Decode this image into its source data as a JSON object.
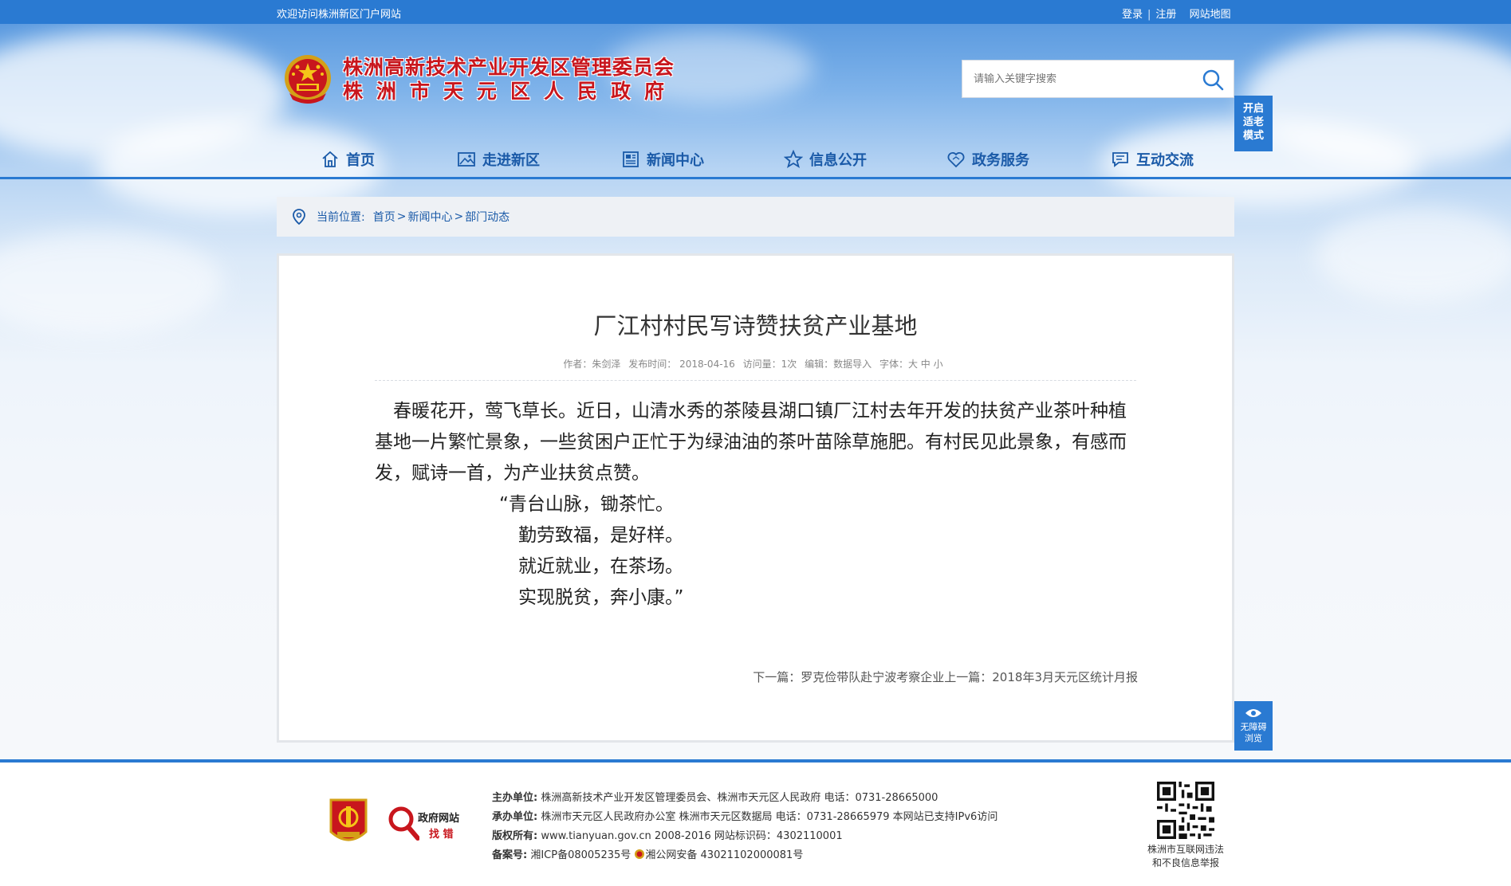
{
  "topbar": {
    "welcome": "欢迎访问株洲新区门户网站",
    "login": "登录",
    "register": "注册",
    "sitemap": "网站地图"
  },
  "header": {
    "title_line1": "株洲高新技术产业开发区管理委员会",
    "title_line2": "株洲市天元区人民政府",
    "search_placeholder": "请输入关键字搜索",
    "elder_mode": "开启\n适老\n模式"
  },
  "nav": [
    {
      "label": "首页",
      "icon": "home-icon"
    },
    {
      "label": "走进新区",
      "icon": "picture-icon"
    },
    {
      "label": "新闻中心",
      "icon": "newspaper-icon"
    },
    {
      "label": "信息公开",
      "icon": "star-icon"
    },
    {
      "label": "政务服务",
      "icon": "heart-icon"
    },
    {
      "label": "互动交流",
      "icon": "chat-icon"
    }
  ],
  "breadcrumb": {
    "label": "当前位置:",
    "items": [
      "首页",
      "新闻中心",
      "部门动态"
    ]
  },
  "article": {
    "title": "厂江村村民写诗赞扶贫产业基地",
    "meta": {
      "author": "作者：朱剑泽",
      "published": "发布时间：  2018-04-16",
      "views": "访问量：1次",
      "editor": "编辑：数据导入",
      "font": "字体：大 中 小"
    },
    "paragraph": "春暖花开，莺飞草长。近日，山清水秀的茶陵县湖口镇厂江村去年开发的扶贫产业茶叶种植基地一片繁忙景象，一些贫困户正忙于为绿油油的茶叶苗除草施肥。有村民见此景象，有感而发，赋诗一首，为产业扶贫点赞。",
    "poem": [
      "“青台山脉，锄茶忙。",
      "勤劳致福，是好样。",
      "就近就业，在茶场。",
      "实现脱贫，奔小康。”"
    ],
    "nextprev": "下一篇：罗克俭带队赴宁波考察企业上一篇：2018年3月天元区统计月报"
  },
  "accessibility": "无障碍\n浏览",
  "footer": {
    "badge2_top": "政府网站",
    "badge2_bottom": "找 错",
    "sponsor_label": "主办单位:",
    "sponsor": "株洲高新技术产业开发区管理委员会、株洲市天元区人民政府 电话：0731-28665000",
    "organizer_label": "承办单位:",
    "organizer": "株洲市天元区人民政府办公室 株洲市天元区数据局 电话：0731-28665979 本网站已支持IPv6访问",
    "copyright_label": "版权所有:",
    "copyright": "www.tianyuan.gov.cn 2008-2016 网站标识码：4302110001",
    "record_label": "备案号:",
    "icp": "湘ICP备08005235号",
    "police": "湘公网安备 43021102000081号",
    "qr_caption": "株洲市互联网违法\n和不良信息举报"
  },
  "colors": {
    "brand_blue": "#2a7ad2",
    "title_red": "#c8161d",
    "nav_text": "#1a5aa8"
  }
}
